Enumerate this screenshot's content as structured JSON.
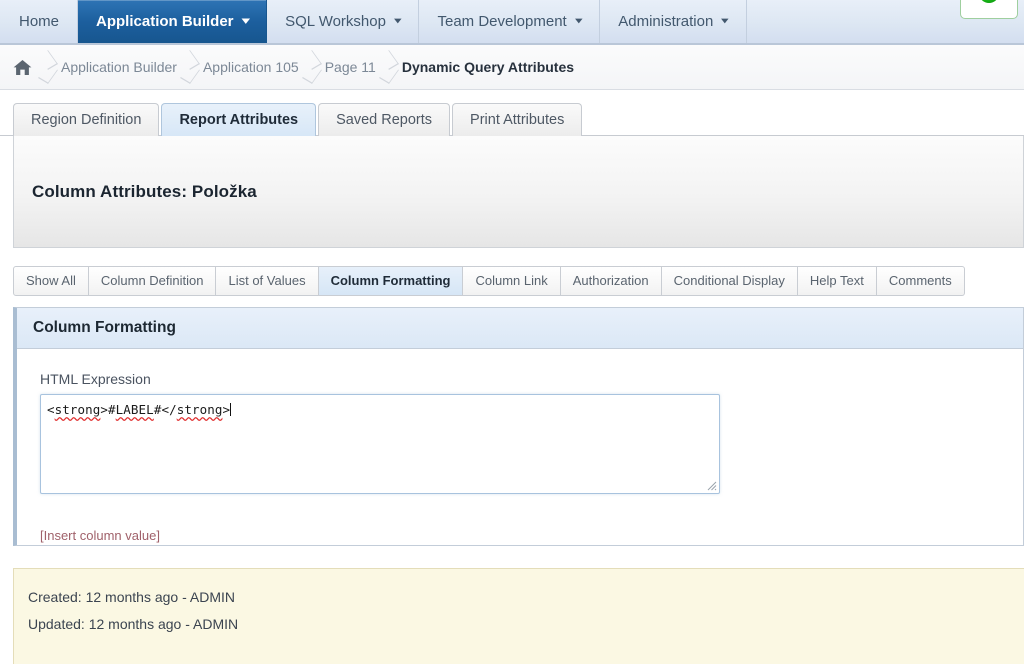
{
  "topnav": {
    "items": [
      {
        "label": "Home",
        "has_caret": false,
        "active": false
      },
      {
        "label": "Application Builder",
        "has_caret": true,
        "active": true
      },
      {
        "label": "SQL Workshop",
        "has_caret": true,
        "active": false
      },
      {
        "label": "Team Development",
        "has_caret": true,
        "active": false
      },
      {
        "label": "Administration",
        "has_caret": true,
        "active": false
      }
    ],
    "caret_glyph": "⌵",
    "badge_icon": "green-status-circle-icon"
  },
  "breadcrumb": {
    "home_icon": "home-icon",
    "items": [
      {
        "label": "Application Builder"
      },
      {
        "label": "Application 105"
      },
      {
        "label": "Page 11"
      },
      {
        "label": "Dynamic Query Attributes"
      }
    ]
  },
  "tabs": [
    {
      "label": "Region Definition",
      "active": false
    },
    {
      "label": "Report Attributes",
      "active": true
    },
    {
      "label": "Saved Reports",
      "active": false
    },
    {
      "label": "Print Attributes",
      "active": false
    }
  ],
  "page_title": "Column Attributes: Položka",
  "subtabs": [
    {
      "label": "Show All",
      "active": false
    },
    {
      "label": "Column Definition",
      "active": false
    },
    {
      "label": "List of Values",
      "active": false
    },
    {
      "label": "Column Formatting",
      "active": true
    },
    {
      "label": "Column Link",
      "active": false
    },
    {
      "label": "Authorization",
      "active": false
    },
    {
      "label": "Conditional Display",
      "active": false
    },
    {
      "label": "Help Text",
      "active": false
    },
    {
      "label": "Comments",
      "active": false
    }
  ],
  "region": {
    "header": "Column Formatting",
    "html_expression_label": "HTML Expression",
    "html_expression_value": "<strong>#LABEL#</strong>",
    "html_expression_parts": {
      "open_lt": "<",
      "open_tag": "strong",
      "open_gt": ">#",
      "token": "LABEL",
      "mid": "#</",
      "close_tag": "strong",
      "close_gt": ">"
    },
    "insert_column_value_link": "[Insert column value]"
  },
  "footer": {
    "created": "Created: 12 months ago - ADMIN",
    "updated": "Updated: 12 months ago - ADMIN"
  },
  "colors": {
    "nav_active": "#1c5f9e",
    "tab_active": "#d7e7f7",
    "region_header": "#dbe8f6",
    "link": "#a0616a",
    "footer_bg": "#fbf8e3",
    "spellcheck_underline": "#e03030",
    "status_green": "#18b818"
  }
}
